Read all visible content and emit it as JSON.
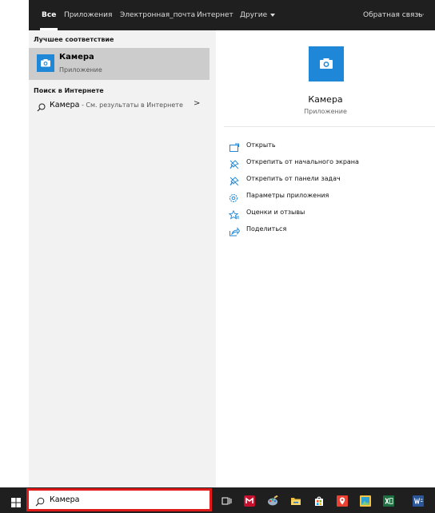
{
  "topbar": {
    "tabs": [
      {
        "label": "Все",
        "active": true
      },
      {
        "label": "Приложения",
        "active": false
      },
      {
        "label": "Электронная_почта",
        "active": false
      },
      {
        "label": "Интернет",
        "active": false
      },
      {
        "label": "Другие",
        "active": false
      }
    ],
    "feedback_label": "Обратная связь",
    "more_label": "···"
  },
  "results": {
    "best_match_header": "Лучшее соответствие",
    "best_match": {
      "title": "Камера",
      "subtitle": "Приложение",
      "icon": "camera-icon"
    },
    "web_header": "Поиск в Интернете",
    "web_result": {
      "query": "Камера",
      "hint": " - См. результаты в Интернете",
      "icon": "search-icon"
    }
  },
  "preview": {
    "title": "Камера",
    "subtitle": "Приложение",
    "actions": [
      {
        "label": "Открыть",
        "icon": "open-icon"
      },
      {
        "label": "Открепить от начального экрана",
        "icon": "unpin-start-icon"
      },
      {
        "label": "Открепить от панели задач",
        "icon": "unpin-taskbar-icon"
      },
      {
        "label": "Параметры приложения",
        "icon": "gear-icon"
      },
      {
        "label": "Оценки и отзывы",
        "icon": "star-icon"
      },
      {
        "label": "Поделиться",
        "icon": "share-icon"
      }
    ]
  },
  "taskbar": {
    "search_query": "Камера",
    "pinned_icons": [
      "task-view-icon",
      "mcafee-icon",
      "paint-icon",
      "file-explorer-icon",
      "store-icon",
      "maps-icon",
      "photos-icon",
      "excel-icon",
      "word-icon"
    ]
  },
  "colors": {
    "accent": "#1e87d8",
    "highlight": "#e01919",
    "dark": "#1f1f1f"
  }
}
